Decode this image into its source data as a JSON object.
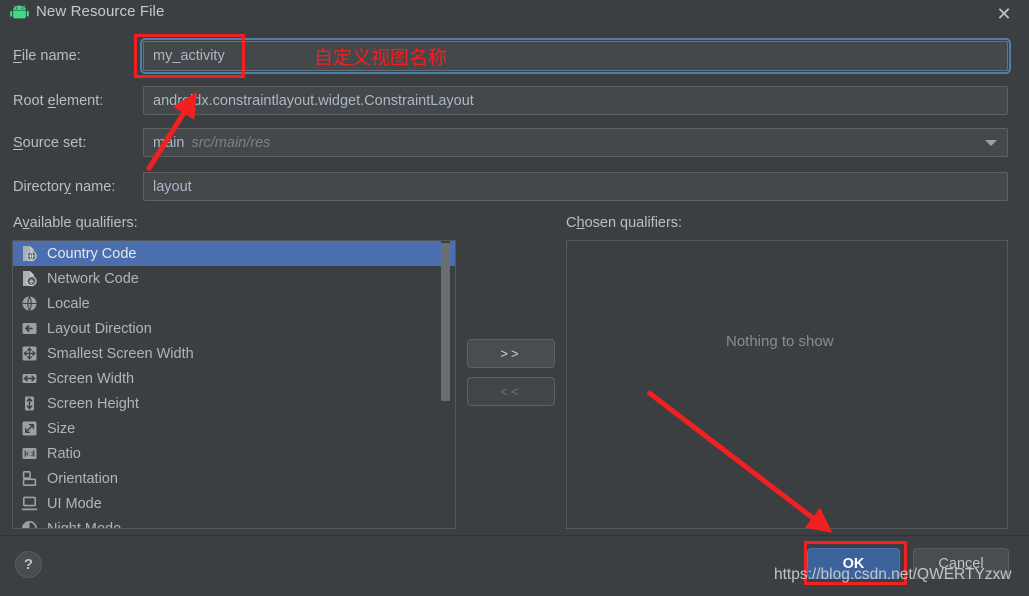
{
  "window": {
    "title": "New Resource File",
    "app_icon": "android-robot-icon",
    "close_icon": "close-icon"
  },
  "form": {
    "file_name": {
      "label": "File name:",
      "label_mnemonic": "F",
      "value": "my_activity",
      "focused": true
    },
    "root_element": {
      "label": "Root element:",
      "label_mnemonic": "e",
      "value": "androidx.constraintlayout.widget.ConstraintLayout"
    },
    "source_set": {
      "label": "Source set:",
      "label_mnemonic": "S",
      "value": "main",
      "hint": "src/main/res",
      "dropdown_icon": "chevron-down-icon"
    },
    "directory_name": {
      "label": "Directory name:",
      "label_mnemonic": "y",
      "value": "layout"
    }
  },
  "available": {
    "label": "Available qualifiers:",
    "label_mnemonic": "v",
    "selected_index": 0,
    "items": [
      {
        "label": "Country Code",
        "icon": "country-code-icon"
      },
      {
        "label": "Network Code",
        "icon": "network-code-icon"
      },
      {
        "label": "Locale",
        "icon": "globe-icon"
      },
      {
        "label": "Layout Direction",
        "icon": "arrow-left-icon"
      },
      {
        "label": "Smallest Screen Width",
        "icon": "four-way-arrow-icon"
      },
      {
        "label": "Screen Width",
        "icon": "arrow-horizontal-icon"
      },
      {
        "label": "Screen Height",
        "icon": "arrow-vertical-icon"
      },
      {
        "label": "Size",
        "icon": "diagonal-arrow-icon"
      },
      {
        "label": "Ratio",
        "icon": "ratio-icon"
      },
      {
        "label": "Orientation",
        "icon": "orientation-icon"
      },
      {
        "label": "UI Mode",
        "icon": "ui-mode-icon"
      },
      {
        "label": "Night Mode",
        "icon": "night-mode-icon"
      }
    ]
  },
  "transfer": {
    "add_label": ">>",
    "remove_label": "<<"
  },
  "chosen": {
    "label": "Chosen qualifiers:",
    "label_mnemonic": "h",
    "empty_text": "Nothing to show",
    "items": []
  },
  "footer": {
    "help_label": "?",
    "ok_label": "OK",
    "cancel_label": "Cancel"
  },
  "annotations": {
    "chinese_note": "自定义视图名称",
    "watermark": "https://blog.csdn.net/QWERTYzxw",
    "highlight_color": "#f22020"
  }
}
